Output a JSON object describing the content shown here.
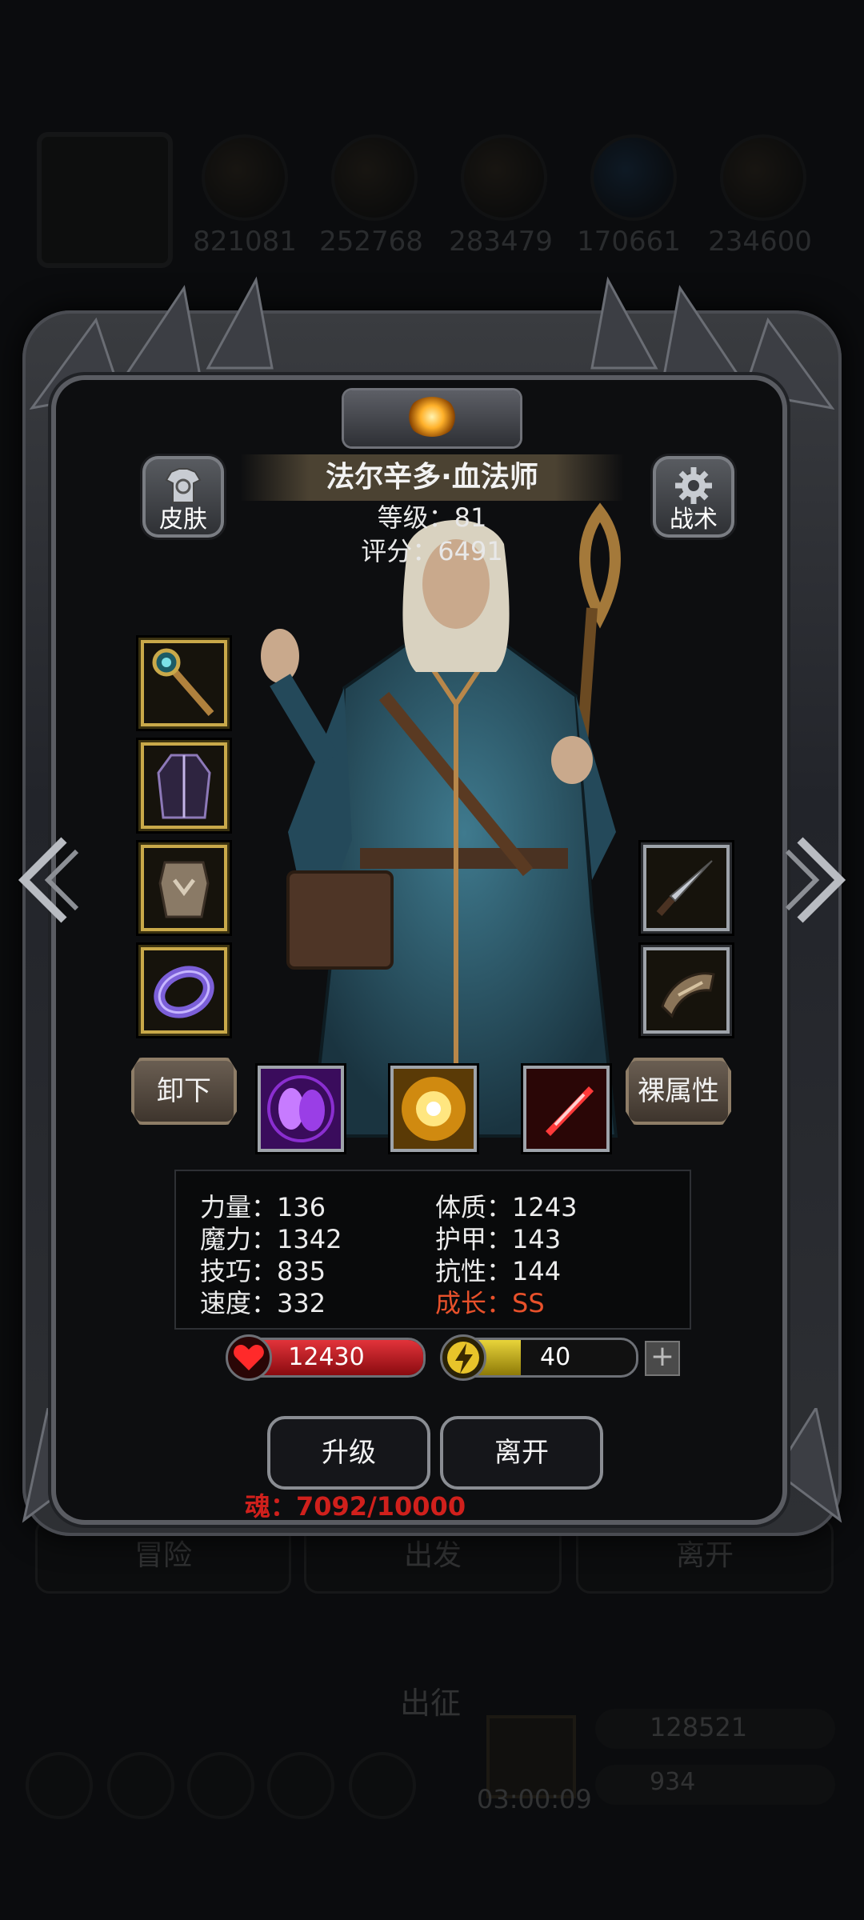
{
  "resources": {
    "values": [
      "821081",
      "252768",
      "283479",
      "170661",
      "234600"
    ]
  },
  "background_tabs": [
    "冒险",
    "出发",
    "离开"
  ],
  "background_bottom": {
    "title": "出征",
    "timer": "03:00:09",
    "gold": "128521",
    "gems": "934"
  },
  "hero": {
    "name": "法尔辛多·血法师",
    "level_text": "等级：81",
    "score_text": "评分：6491"
  },
  "buttons": {
    "skin": "皮肤",
    "tactics": "战术",
    "unequip": "卸下",
    "base_attrs": "裸属性",
    "upgrade": "升级",
    "leave": "离开"
  },
  "equipment_left": [
    "staff-icon",
    "robe-icon",
    "armor-icon",
    "ring-icon"
  ],
  "equipment_right": [
    "dagger-icon",
    "bracer-icon"
  ],
  "skills": [
    "shadow-skill-icon",
    "light-burst-skill-icon",
    "red-slash-skill-icon"
  ],
  "stats": {
    "strength": "力量：136",
    "constitution": "体质：1243",
    "magic": "魔力：1342",
    "armor": "护甲：143",
    "skill": "技巧：835",
    "resistance": "抗性：144",
    "speed": "速度：332",
    "growth": "成长：SS"
  },
  "health": {
    "value": "12430",
    "fill": 1.0
  },
  "energy": {
    "value": "40",
    "fill": 0.4
  },
  "soul": "魂：7092/10000",
  "colors": {
    "health_bar": "#c0141a",
    "energy_bar": "#c8b21e",
    "growth_text": "#e8512b",
    "soul_text": "#d0201c",
    "equip_border": "#c9a94a"
  }
}
